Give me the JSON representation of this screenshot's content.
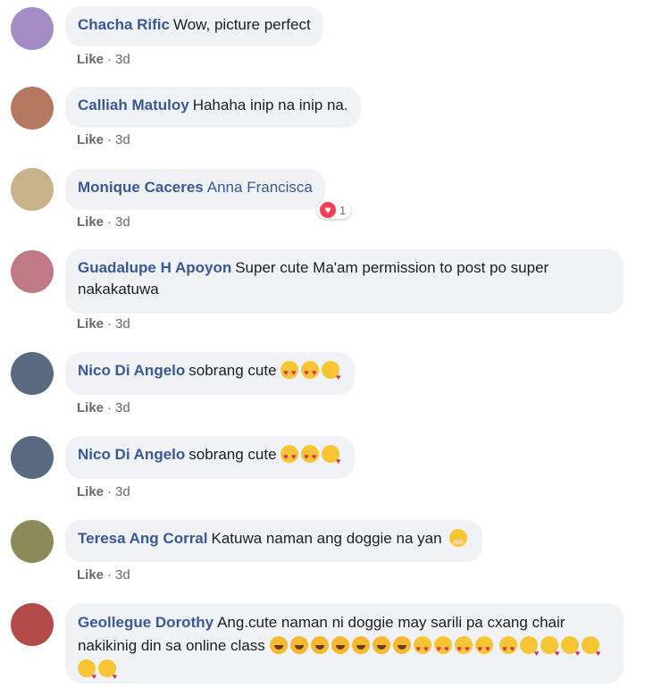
{
  "comments": [
    {
      "author": "Chacha Rific",
      "text": "Wow, picture perfect",
      "like": "Like",
      "time": "3d",
      "avatar_color": "#a58cc4"
    },
    {
      "author": "Calliah Matuloy",
      "text": "Hahaha inip na inip na.",
      "like": "Like",
      "time": "3d",
      "avatar_color": "#b57860"
    },
    {
      "author": "Monique Caceres",
      "text": "Anna Francisca",
      "like": "Like",
      "time": "3d",
      "avatar_color": "#c9b28a",
      "reaction_icon": "love-icon",
      "reaction_count": "1"
    },
    {
      "author": "Guadalupe H Apoyon",
      "text": "Super cute Ma'am permission to post po super nakakatuwa",
      "like": "Like",
      "time": "3d",
      "avatar_color": "#c07a86"
    },
    {
      "author": "Nico Di Angelo",
      "text": "sobrang cute",
      "like": "Like",
      "time": "3d",
      "avatar_color": "#5a6a80"
    },
    {
      "author": "Nico Di Angelo",
      "text": "sobrang cute",
      "like": "Like",
      "time": "3d",
      "avatar_color": "#5a6a80"
    },
    {
      "author": "Teresa Ang Corral",
      "text": "Katuwa naman ang doggie na yan",
      "like": "Like",
      "time": "3d",
      "avatar_color": "#8d8a5a"
    },
    {
      "author": "Geollegue Dorothy",
      "text": "Ang.cute naman ni doggie may sarili pa cxang chair nakikinig din sa online class",
      "like": "Like",
      "time": "3d",
      "avatar_color": "#b34a4a"
    }
  ],
  "emoji": {
    "c5": [
      "heart-eyes",
      "heart-eyes",
      "kiss"
    ],
    "c6": [
      "heart-eyes",
      "heart-eyes",
      "kiss"
    ],
    "c7": [
      "hug"
    ],
    "c8_line1": [
      "laugh",
      "laugh",
      "laugh",
      "laugh",
      "laugh",
      "laugh",
      "laugh",
      "heart-eyes",
      "heart-eyes",
      "heart-eyes",
      "heart-eyes"
    ],
    "c8_line2": [
      "heart-eyes",
      "kiss",
      "kiss",
      "kiss",
      "kiss",
      "kiss",
      "kiss"
    ]
  },
  "colors": {
    "author_blue": "#385898",
    "bubble_bg": "#f0f2f5",
    "meta_gray": "#65676b",
    "love_red": "#f33e58"
  }
}
